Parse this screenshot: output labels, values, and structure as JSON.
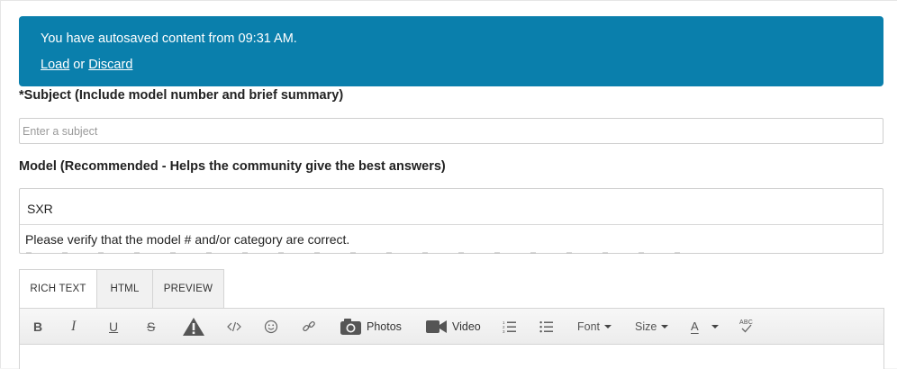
{
  "banner": {
    "message": "You have autosaved content from 09:31 AM.",
    "load_label": "Load",
    "or_text": "or",
    "discard_label": "Discard"
  },
  "subject": {
    "label": "*Subject (Include model number and brief summary)",
    "placeholder": "Enter a subject",
    "value": ""
  },
  "model": {
    "label": "Model (Recommended - Helps the community give the best answers)",
    "value": "SXR",
    "hint": "Please verify that the model # and/or category are correct."
  },
  "editor": {
    "tabs": [
      {
        "label": "RICH TEXT",
        "active": true
      },
      {
        "label": "HTML",
        "active": false
      },
      {
        "label": "PREVIEW",
        "active": false
      }
    ],
    "toolbar": {
      "bold_label": "B",
      "italic_label": "I",
      "underline_label": "U",
      "strike_label": "S",
      "photos_label": "Photos",
      "video_label": "Video",
      "font_label": "Font",
      "size_label": "Size",
      "color_label": "A",
      "spellcheck_label": "ABC"
    },
    "icons": [
      "bold-icon",
      "italic-icon",
      "underline-icon",
      "strikethrough-icon",
      "warning-icon",
      "code-icon",
      "emoji-icon",
      "link-icon",
      "camera-icon",
      "video-camera-icon",
      "numbered-list-icon",
      "bulleted-list-icon",
      "font-color-icon",
      "spellcheck-icon"
    ]
  },
  "colors": {
    "banner_bg": "#0a7fac",
    "banner_text": "#ffffff"
  }
}
